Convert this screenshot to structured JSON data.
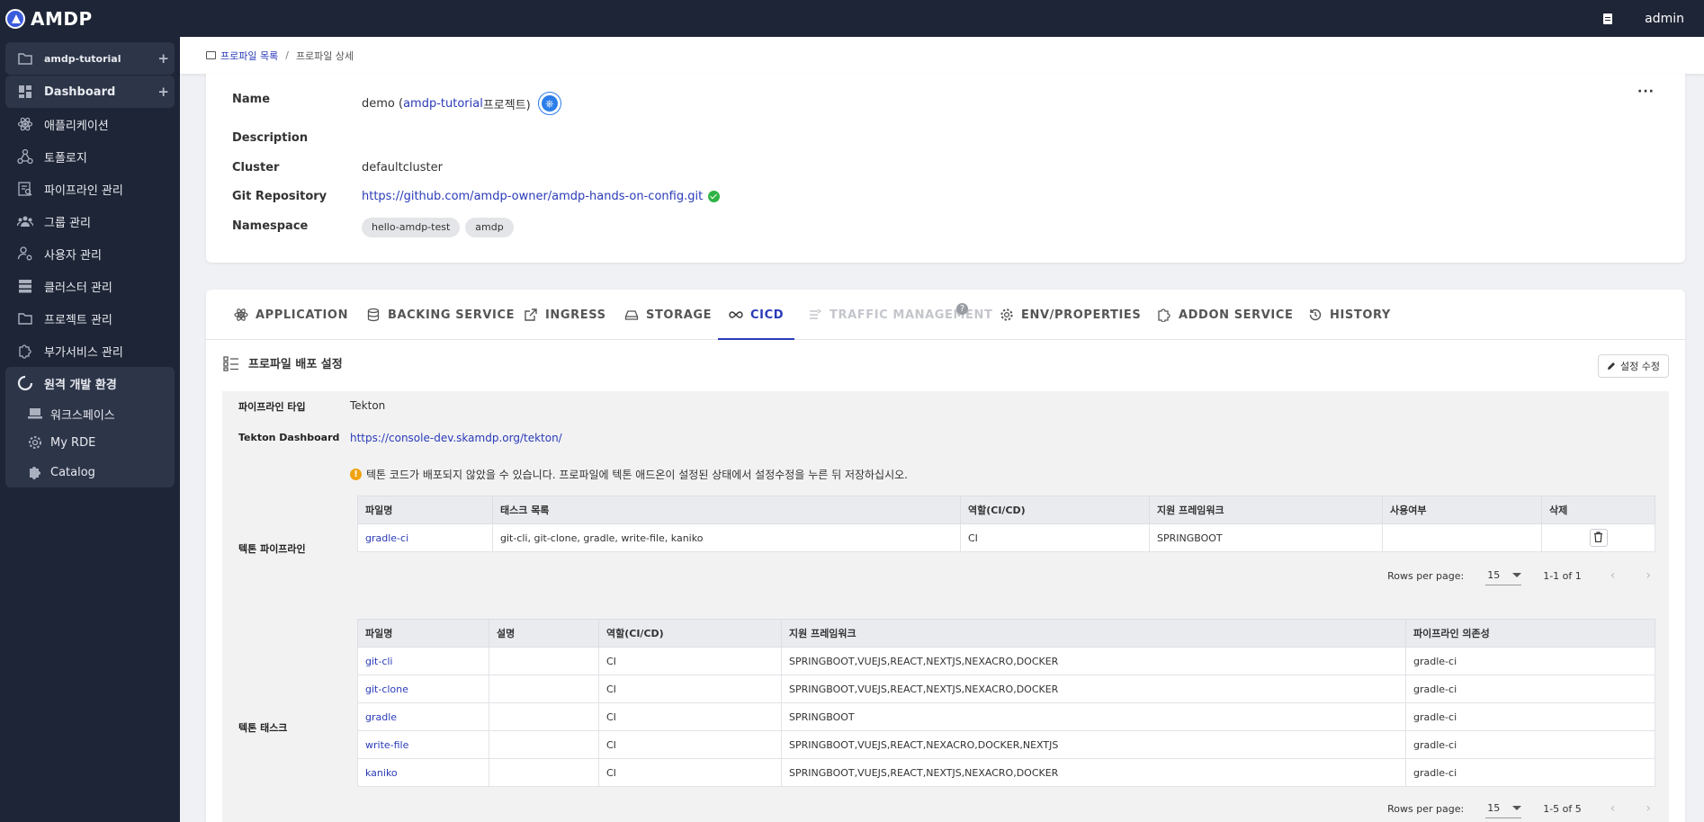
{
  "app": {
    "title": "AMDP",
    "user": "admin"
  },
  "sidebar": {
    "project": "amdp-tutorial",
    "items": [
      {
        "label": "Dashboard",
        "icon": "dashboard-icon"
      },
      {
        "label": "애플리케이션",
        "icon": "atom-icon"
      },
      {
        "label": "토폴로지",
        "icon": "topology-icon"
      },
      {
        "label": "파이프라인 관리",
        "icon": "pipeline-icon"
      },
      {
        "label": "그룹 관리",
        "icon": "group-icon"
      },
      {
        "label": "사용자 관리",
        "icon": "user-settings-icon"
      },
      {
        "label": "클러스터 관리",
        "icon": "cluster-icon"
      },
      {
        "label": "프로젝트 관리",
        "icon": "folder-icon"
      },
      {
        "label": "부가서비스 관리",
        "icon": "puzzle-settings-icon"
      }
    ],
    "rde": {
      "label": "원격 개발 환경",
      "children": [
        "워크스페이스",
        "My RDE",
        "Catalog"
      ]
    }
  },
  "breadcrumb": {
    "parent": "프로파일 목록",
    "sep": "/",
    "current": "프로파일 상세"
  },
  "profile": {
    "name_label": "Name",
    "name_value": "demo (",
    "name_project": "amdp-tutorial",
    "name_suffix": "프로젝트)",
    "description_label": "Description",
    "cluster_label": "Cluster",
    "cluster_value": "defaultcluster",
    "git_label": "Git Repository",
    "git_value": "https://github.com/amdp-owner/amdp-hands-on-config.git",
    "namespace_label": "Namespace",
    "namespaces": [
      "hello-amdp-test",
      "amdp"
    ],
    "more": "···"
  },
  "tabs": [
    {
      "label": "APPLICATION",
      "icon": "atom-icon"
    },
    {
      "label": "BACKING SERVICE",
      "icon": "database-icon"
    },
    {
      "label": "INGRESS",
      "icon": "external-link-icon"
    },
    {
      "label": "STORAGE",
      "icon": "storage-icon"
    },
    {
      "label": "CICD",
      "icon": "infinity-icon"
    },
    {
      "label": "TRAFFIC MANAGEMENT",
      "icon": "traffic-icon"
    },
    {
      "label": "ENV/PROPERTIES",
      "icon": "gear-icon"
    },
    {
      "label": "ADDON SERVICE",
      "icon": "puzzle-icon"
    },
    {
      "label": "HISTORY",
      "icon": "history-icon"
    }
  ],
  "help": "?",
  "cicd": {
    "section_title": "프로파일 배포 설정",
    "edit_label": "설정 수정",
    "pipeline_type_label": "파이프라인 타입",
    "pipeline_type_value": "Tekton",
    "dashboard_label": "Tekton Dashboard",
    "dashboard_value": "https://console-dev.skamdp.org/tekton/",
    "warning": "텍톤 코드가 배포되지 않았을 수 있습니다. 프로파일에 텍톤 애드온이 설정된 상태에서 설정수정을 누른 뒤 저장하십시오.",
    "pipeline_label": "텍톤 파이프라인",
    "pipeline_table": {
      "headers": [
        "파일명",
        "태스크 목록",
        "역할(CI/CD)",
        "지원 프레임워크",
        "사용여부",
        "삭제"
      ],
      "rows": [
        [
          "gradle-ci",
          "git-cli, git-clone, gradle, write-file, kaniko",
          "CI",
          "SPRINGBOOT",
          ""
        ]
      ],
      "rows_per_page_label": "Rows per page:",
      "rows_per_page": "15",
      "range": "1-1 of 1"
    },
    "task_label": "텍톤 태스크",
    "task_table": {
      "headers": [
        "파일명",
        "설명",
        "역할(CI/CD)",
        "지원 프레임워크",
        "파이프라인 의존성"
      ],
      "rows": [
        [
          "git-cli",
          "",
          "CI",
          "SPRINGBOOT,VUEJS,REACT,NEXTJS,NEXACRO,DOCKER",
          "gradle-ci"
        ],
        [
          "git-clone",
          "",
          "CI",
          "SPRINGBOOT,VUEJS,REACT,NEXTJS,NEXACRO,DOCKER",
          "gradle-ci"
        ],
        [
          "gradle",
          "",
          "CI",
          "SPRINGBOOT",
          "gradle-ci"
        ],
        [
          "write-file",
          "",
          "CI",
          "SPRINGBOOT,VUEJS,REACT,NEXACRO,DOCKER,NEXTJS",
          "gradle-ci"
        ],
        [
          "kaniko",
          "",
          "CI",
          "SPRINGBOOT,VUEJS,REACT,NEXTJS,NEXACRO,DOCKER",
          "gradle-ci"
        ]
      ],
      "rows_per_page_label": "Rows per page:",
      "rows_per_page": "15",
      "range": "1-5 of 5"
    }
  }
}
